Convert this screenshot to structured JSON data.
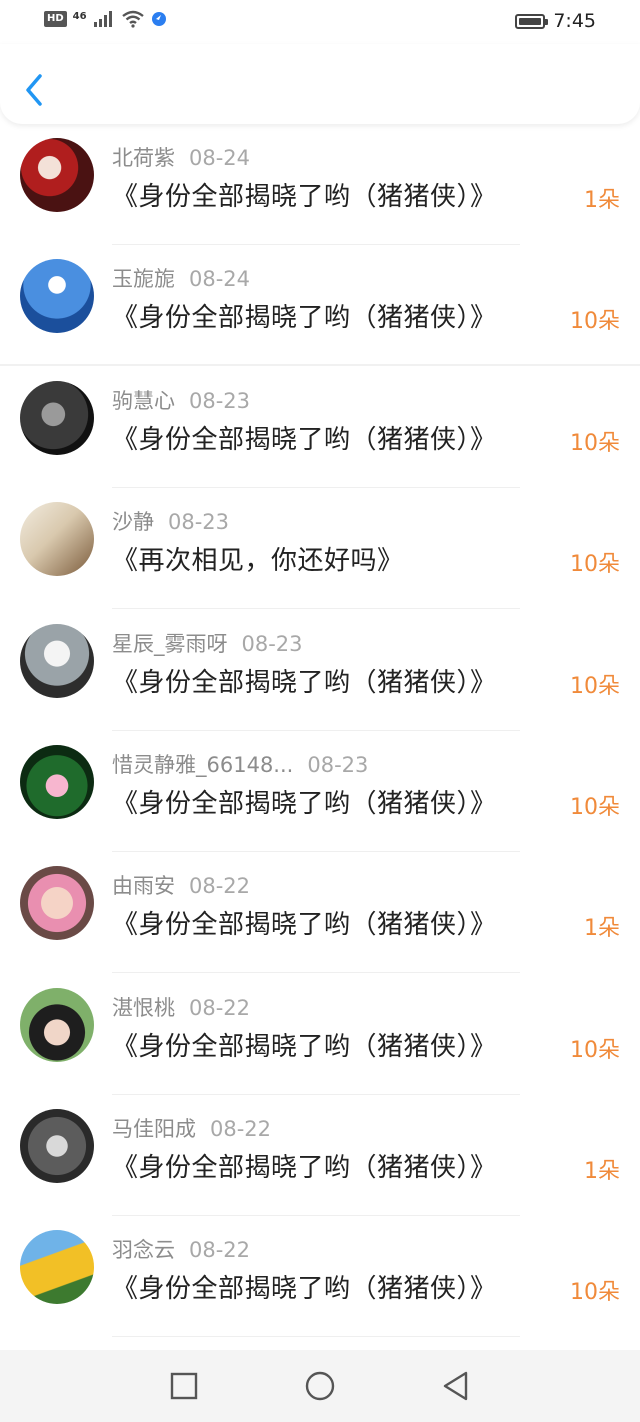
{
  "status_bar": {
    "hd": "HD",
    "network": "46",
    "time": "7:45"
  },
  "icons": {
    "back": "chevron-left-icon",
    "nav_recent": "square-icon",
    "nav_home": "circle-icon",
    "nav_back": "triangle-back-icon"
  },
  "colors": {
    "accent_blue": "#2196f3",
    "amount_orange": "#f08a3a"
  },
  "items": [
    {
      "name": "北荷紫",
      "date": "08-24",
      "title": "《身份全部揭晓了哟（猪猪侠）》",
      "amount": "1朵"
    },
    {
      "name": "玉旎旎",
      "date": "08-24",
      "title": "《身份全部揭晓了哟（猪猪侠）》",
      "amount": "10朵"
    },
    {
      "name": "驹慧心",
      "date": "08-23",
      "title": "《身份全部揭晓了哟（猪猪侠）》",
      "amount": "10朵"
    },
    {
      "name": "沙静",
      "date": "08-23",
      "title": "《再次相见，你还好吗》",
      "amount": "10朵"
    },
    {
      "name": "星辰_雾雨呀",
      "date": "08-23",
      "title": "《身份全部揭晓了哟（猪猪侠）》",
      "amount": "10朵"
    },
    {
      "name": "惜灵静雅_66148...",
      "date": "08-23",
      "title": "《身份全部揭晓了哟（猪猪侠）》",
      "amount": "10朵"
    },
    {
      "name": "由雨安",
      "date": "08-22",
      "title": "《身份全部揭晓了哟（猪猪侠）》",
      "amount": "1朵"
    },
    {
      "name": "湛恨桃",
      "date": "08-22",
      "title": "《身份全部揭晓了哟（猪猪侠）》",
      "amount": "10朵"
    },
    {
      "name": "马佳阳成",
      "date": "08-22",
      "title": "《身份全部揭晓了哟（猪猪侠）》",
      "amount": "1朵"
    },
    {
      "name": "羽念云",
      "date": "08-22",
      "title": "《身份全部揭晓了哟（猪猪侠）》",
      "amount": "10朵"
    }
  ]
}
